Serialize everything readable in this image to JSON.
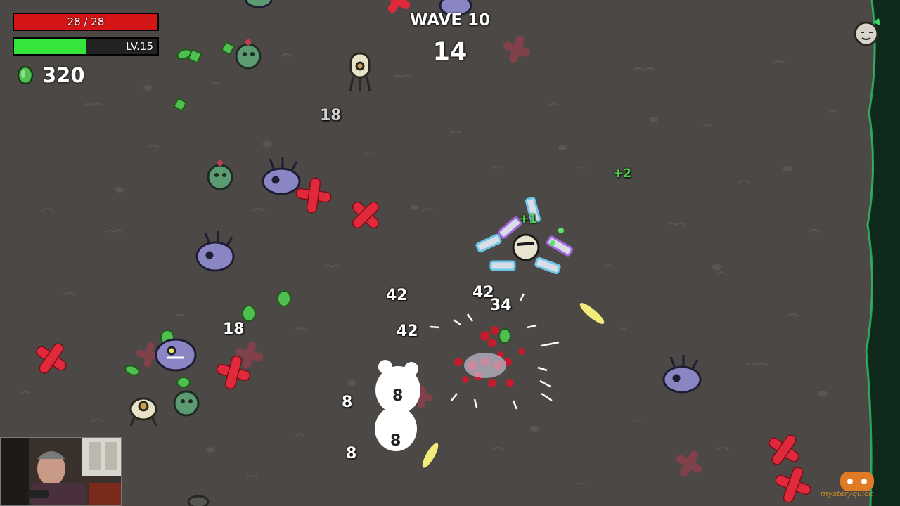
{
  "hud": {
    "hp_text": "28 / 28",
    "hp_fraction": 1.0,
    "level_text": "LV.15",
    "xp_fraction": 0.5,
    "materials": "320"
  },
  "wave": {
    "title": "WAVE 10",
    "timer": "14"
  },
  "damage_numbers": [
    {
      "text": "18",
      "style": "gray"
    },
    {
      "text": "42",
      "style": "white"
    },
    {
      "text": "42",
      "style": "white"
    },
    {
      "text": "42",
      "style": "white"
    },
    {
      "text": "34",
      "style": "white"
    },
    {
      "text": "18",
      "style": "white"
    },
    {
      "text": "8",
      "style": "white"
    },
    {
      "text": "8",
      "style": "white"
    },
    {
      "text": "8",
      "style": "white"
    },
    {
      "text": "8",
      "style": "white"
    },
    {
      "text": "+2",
      "style": "green"
    },
    {
      "text": "+1",
      "style": "green"
    }
  ],
  "logo": "mysteryquick",
  "colors": {
    "hp": "#d41515",
    "xp": "#35e63a",
    "material": "#4fbf4f",
    "ground": "#4b4845",
    "enemy_marker": "#d8283a"
  }
}
